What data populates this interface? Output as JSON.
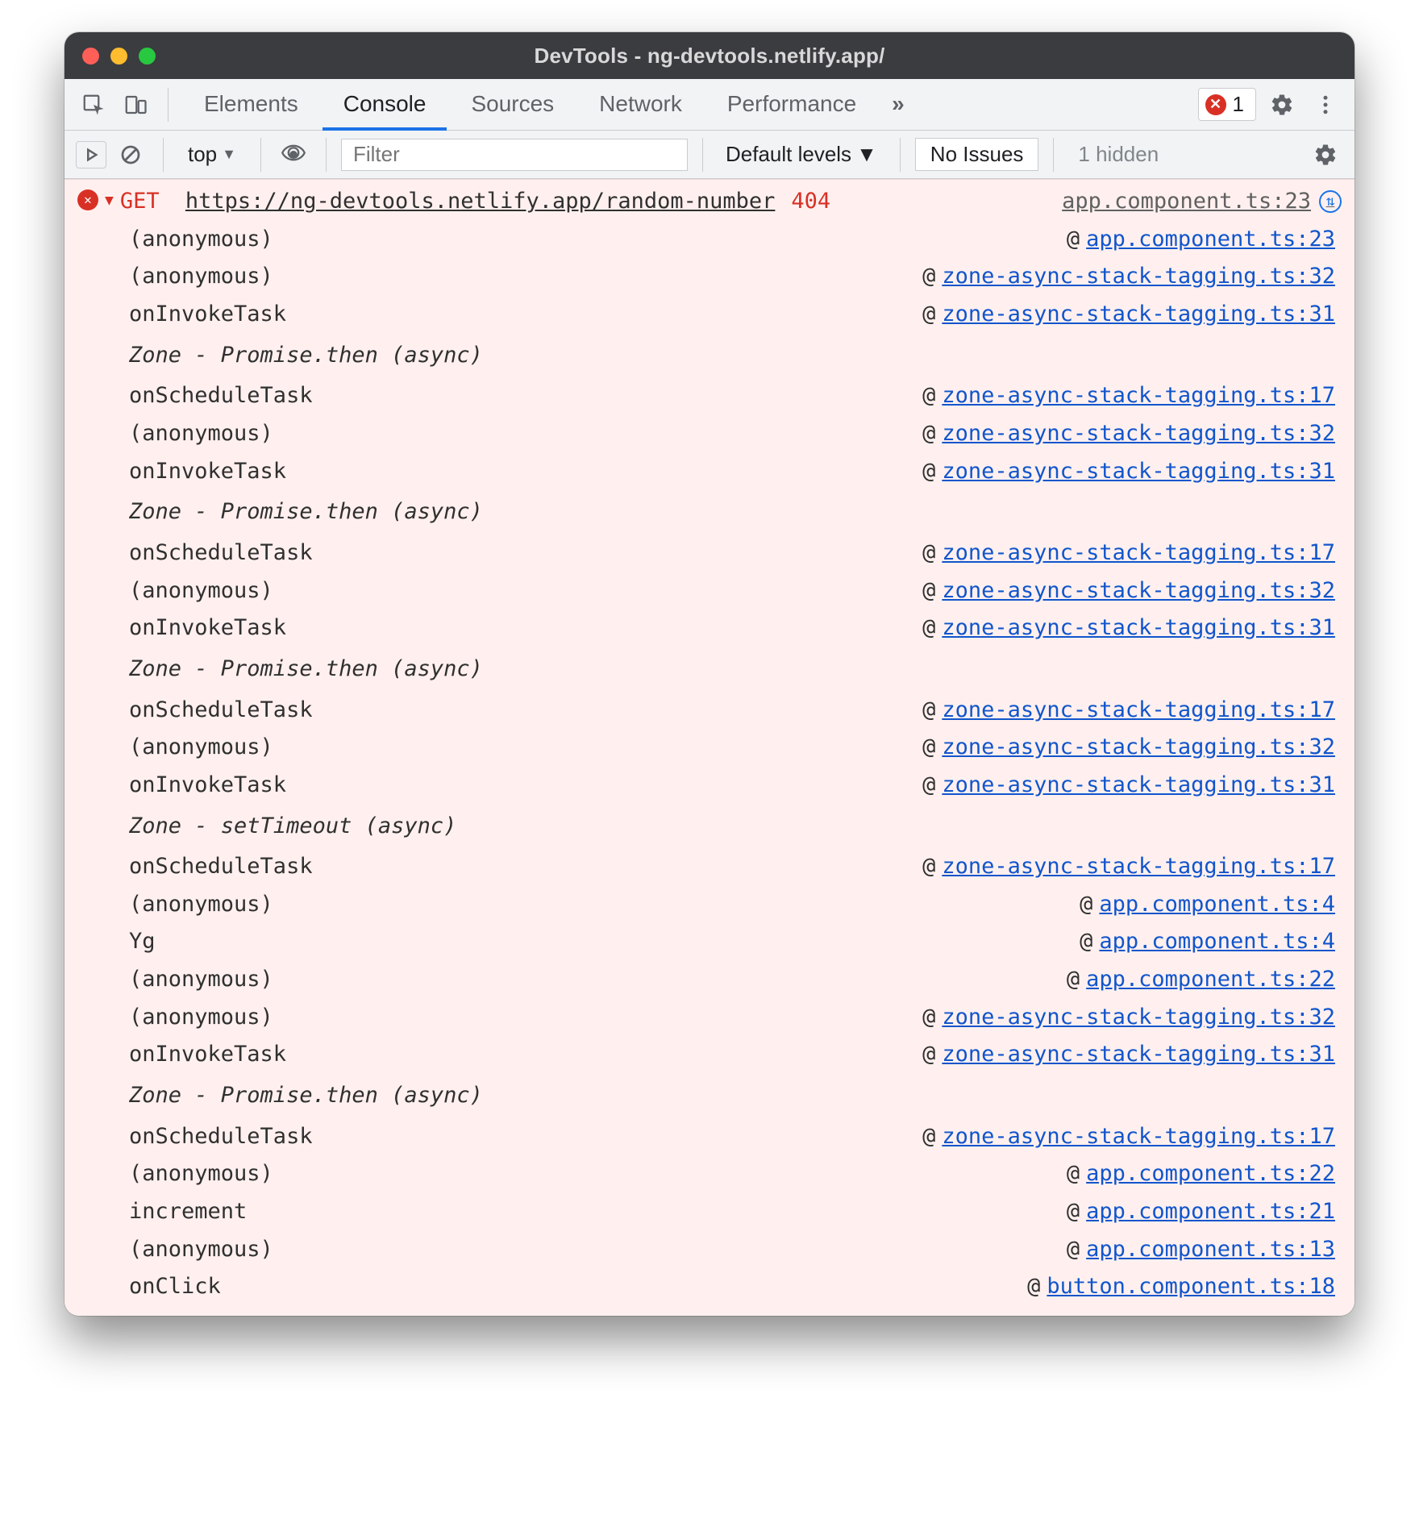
{
  "title": "DevTools - ng-devtools.netlify.app/",
  "tabs": {
    "elements": "Elements",
    "console": "Console",
    "sources": "Sources",
    "network": "Network",
    "performance": "Performance",
    "more_glyph": "»"
  },
  "error_pill": {
    "count": "1"
  },
  "console_toolbar": {
    "context": "top",
    "filter_placeholder": "Filter",
    "levels": "Default levels",
    "no_issues": "No Issues",
    "hidden": "1 hidden"
  },
  "message": {
    "verb": "GET",
    "url": "https://ng-devtools.netlify.app/random-number",
    "status": "404",
    "origin": "app.component.ts:23"
  },
  "at_sign": "@",
  "trace": [
    {
      "type": "frame",
      "fn": "(anonymous)",
      "link": "app.component.ts:23"
    },
    {
      "type": "frame",
      "fn": "(anonymous)",
      "link": "zone-async-stack-tagging.ts:32"
    },
    {
      "type": "frame",
      "fn": "onInvokeTask",
      "link": "zone-async-stack-tagging.ts:31"
    },
    {
      "type": "zone",
      "label": "Zone - Promise.then (async)"
    },
    {
      "type": "frame",
      "fn": "onScheduleTask",
      "link": "zone-async-stack-tagging.ts:17"
    },
    {
      "type": "frame",
      "fn": "(anonymous)",
      "link": "zone-async-stack-tagging.ts:32"
    },
    {
      "type": "frame",
      "fn": "onInvokeTask",
      "link": "zone-async-stack-tagging.ts:31"
    },
    {
      "type": "zone",
      "label": "Zone - Promise.then (async)"
    },
    {
      "type": "frame",
      "fn": "onScheduleTask",
      "link": "zone-async-stack-tagging.ts:17"
    },
    {
      "type": "frame",
      "fn": "(anonymous)",
      "link": "zone-async-stack-tagging.ts:32"
    },
    {
      "type": "frame",
      "fn": "onInvokeTask",
      "link": "zone-async-stack-tagging.ts:31"
    },
    {
      "type": "zone",
      "label": "Zone - Promise.then (async)"
    },
    {
      "type": "frame",
      "fn": "onScheduleTask",
      "link": "zone-async-stack-tagging.ts:17"
    },
    {
      "type": "frame",
      "fn": "(anonymous)",
      "link": "zone-async-stack-tagging.ts:32"
    },
    {
      "type": "frame",
      "fn": "onInvokeTask",
      "link": "zone-async-stack-tagging.ts:31"
    },
    {
      "type": "zone",
      "label": "Zone - setTimeout (async)"
    },
    {
      "type": "frame",
      "fn": "onScheduleTask",
      "link": "zone-async-stack-tagging.ts:17"
    },
    {
      "type": "frame",
      "fn": "(anonymous)",
      "link": "app.component.ts:4"
    },
    {
      "type": "frame",
      "fn": "Yg",
      "link": "app.component.ts:4"
    },
    {
      "type": "frame",
      "fn": "(anonymous)",
      "link": "app.component.ts:22"
    },
    {
      "type": "frame",
      "fn": "(anonymous)",
      "link": "zone-async-stack-tagging.ts:32"
    },
    {
      "type": "frame",
      "fn": "onInvokeTask",
      "link": "zone-async-stack-tagging.ts:31"
    },
    {
      "type": "zone",
      "label": "Zone - Promise.then (async)"
    },
    {
      "type": "frame",
      "fn": "onScheduleTask",
      "link": "zone-async-stack-tagging.ts:17"
    },
    {
      "type": "frame",
      "fn": "(anonymous)",
      "link": "app.component.ts:22"
    },
    {
      "type": "frame",
      "fn": "increment",
      "link": "app.component.ts:21"
    },
    {
      "type": "frame",
      "fn": "(anonymous)",
      "link": "app.component.ts:13"
    },
    {
      "type": "frame",
      "fn": "onClick",
      "link": "button.component.ts:18"
    }
  ]
}
